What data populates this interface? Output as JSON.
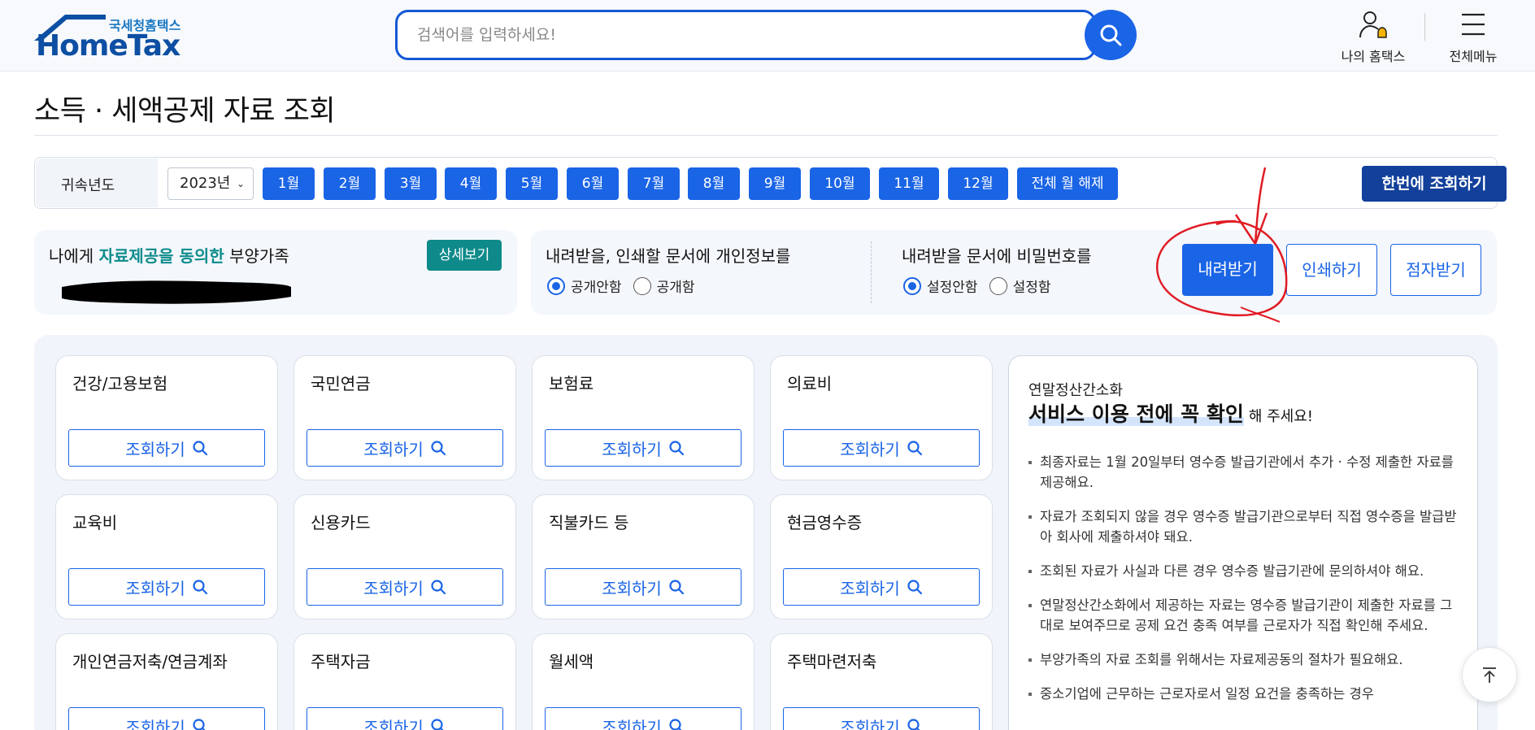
{
  "header": {
    "logo_sub": "국세청홈택스",
    "logo_main": "HomeTax",
    "search_placeholder": "검색어를 입력하세요!",
    "my_hometax": "나의 홈택스",
    "all_menu": "전체메뉴"
  },
  "page": {
    "title": "소득 · 세액공제 자료 조회"
  },
  "filter": {
    "label": "귀속년도",
    "year": "2023년",
    "months": [
      "1월",
      "2월",
      "3월",
      "4월",
      "5월",
      "6월",
      "7월",
      "8월",
      "9월",
      "10월",
      "11월",
      "12월"
    ],
    "clear_all": "전체 월 해제",
    "lookup_all": "한번에 조회하기"
  },
  "consent": {
    "prefix": "나에게 ",
    "highlight": "자료제공을 동의한",
    "suffix": " 부양가족",
    "detail_button": "상세보기"
  },
  "privacy": {
    "title": "내려받을, 인쇄할 문서에 개인정보를",
    "option_hide": "공개안함",
    "option_show": "공개함",
    "selected": "공개안함"
  },
  "password": {
    "title": "내려받을 문서에 비밀번호를",
    "option_off": "설정안함",
    "option_on": "설정함",
    "selected": "설정안함"
  },
  "actions": {
    "download": "내려받기",
    "print": "인쇄하기",
    "braille": "점자받기"
  },
  "cards": {
    "button_label": "조회하기",
    "items": [
      "건강/고용보험",
      "국민연금",
      "보험료",
      "의료비",
      "교육비",
      "신용카드",
      "직불카드 등",
      "현금영수증",
      "개인연금저축/연금계좌",
      "주택자금",
      "월세액",
      "주택마련저축"
    ]
  },
  "info": {
    "sub": "연말정산간소화",
    "head_mark": "서비스 이용 전에 꼭 확인",
    "head_tail": "해 주세요!",
    "items": [
      "최종자료는 1월 20일부터 영수증 발급기관에서 추가 · 수정 제출한 자료를 제공해요.",
      "자료가 조회되지 않을 경우 영수증 발급기관으로부터 직접 영수증을 발급받아 회사에 제출하셔야 돼요.",
      "조회된 자료가 사실과 다른 경우 영수증 발급기관에 문의하셔야 해요.",
      "연말정산간소화에서 제공하는 자료는 영수증 발급기관이 제출한 자료를 그대로 보여주므로 공제 요건 충족 여부를 근로자가 직접 확인해 주세요.",
      "부양가족의 자료 조회를 위해서는 자료제공동의 절차가 필요해요.",
      "중소기업에 근무하는 근로자로서 일정 요건을 충족하는 경우"
    ]
  },
  "colors": {
    "primary": "#1a64e6",
    "dark_button": "#12409a",
    "teal": "#0f8a8a",
    "annotation_red": "#e01b24"
  }
}
